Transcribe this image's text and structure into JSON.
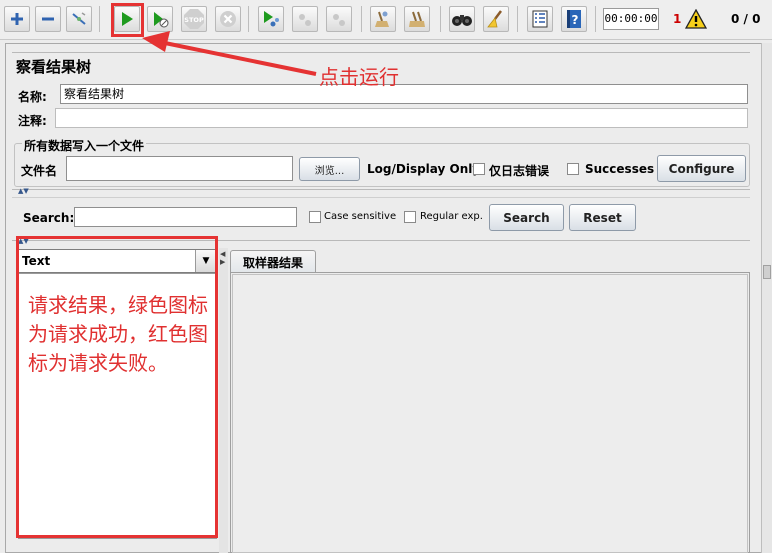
{
  "toolbar": {
    "buttons": [
      {
        "name": "add-icon"
      },
      {
        "name": "remove-icon"
      },
      {
        "name": "clear-toggle-icon"
      },
      {
        "name": "start-icon"
      },
      {
        "name": "start-no-pause-icon"
      },
      {
        "name": "stop-icon",
        "label": "STOP"
      },
      {
        "name": "shutdown-icon"
      },
      {
        "name": "remote-start-icon"
      },
      {
        "name": "remote-stop-icon"
      },
      {
        "name": "remote-exit-icon"
      },
      {
        "name": "clear-icon"
      },
      {
        "name": "clear-all-icon"
      },
      {
        "name": "search-binoculars-icon"
      },
      {
        "name": "broom-reset-icon"
      },
      {
        "name": "function-helper-icon"
      },
      {
        "name": "help-icon"
      }
    ],
    "elapsed_time": "00:00:00",
    "warning_count": "1",
    "thread_count": "0 / 0"
  },
  "panel": {
    "title": "察看结果树",
    "name_label": "名称:",
    "name_value": "察看结果树",
    "comment_label": "注释:",
    "comment_value": "",
    "file_section_title": "所有数据写入一个文件",
    "filename_label": "文件名",
    "filename_value": "",
    "browse_label": "浏览...",
    "log_display_label": "Log/Display Only:",
    "errors_only_label": "仅日志错误",
    "successes_label": "Successes",
    "configure_label": "Configure"
  },
  "search": {
    "label": "Search:",
    "value": "",
    "case_sensitive_label": "Case sensitive",
    "regex_label": "Regular exp.",
    "search_button": "Search",
    "reset_button": "Reset"
  },
  "results": {
    "renderer_selected": "Text",
    "tab_label": "取样器结果"
  },
  "annotations": {
    "run_note": "点击运行",
    "result_note": "请求结果，绿色图标为请求成功，红色图标为请求失败。"
  },
  "colors": {
    "annotation_red": "#e53333",
    "start_green": "#1e9a1e"
  }
}
